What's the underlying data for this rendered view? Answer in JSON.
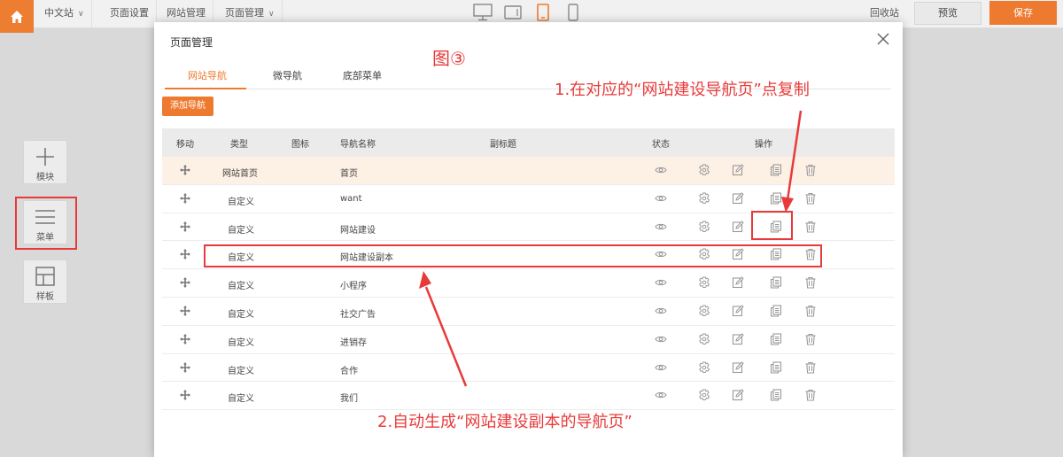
{
  "topbar": {
    "items": [
      {
        "label": "中文站"
      },
      {
        "label": "页面设置"
      },
      {
        "label": "网站管理"
      },
      {
        "label": "页面管理"
      }
    ],
    "recycle_label": "回收站",
    "preview_label": "预览",
    "save_label": "保存"
  },
  "left_tools": [
    {
      "label": "模块"
    },
    {
      "label": "菜单"
    },
    {
      "label": "样板"
    }
  ],
  "modal": {
    "title": "页面管理",
    "tabs": [
      {
        "label": "网站导航",
        "active": true
      },
      {
        "label": "微导航",
        "active": false
      },
      {
        "label": "底部菜单",
        "active": false
      }
    ],
    "add_button": "添加导航",
    "columns": [
      "移动",
      "类型",
      "图标",
      "导航名称",
      "副标题",
      "状态",
      "操作"
    ],
    "rows": [
      {
        "type": "网站首页",
        "name": "首页"
      },
      {
        "type": "自定义",
        "name": "want"
      },
      {
        "type": "自定义",
        "name": "网站建设"
      },
      {
        "type": "自定义",
        "name": "网站建设副本"
      },
      {
        "type": "自定义",
        "name": "小程序"
      },
      {
        "type": "自定义",
        "name": "社交广告"
      },
      {
        "type": "自定义",
        "name": "进销存"
      },
      {
        "type": "自定义",
        "name": "合作"
      },
      {
        "type": "自定义",
        "name": "我们"
      }
    ]
  },
  "annotations": {
    "figure": "图③",
    "step1": "1.在对应的“网站建设导航页”点复制",
    "step2": "2.自动生成“网站建设副本的导航页”"
  },
  "colors": {
    "accent": "#ee7a2f",
    "annotation_red": "#e83a3a",
    "highlight_row": "#fdf1e6"
  }
}
